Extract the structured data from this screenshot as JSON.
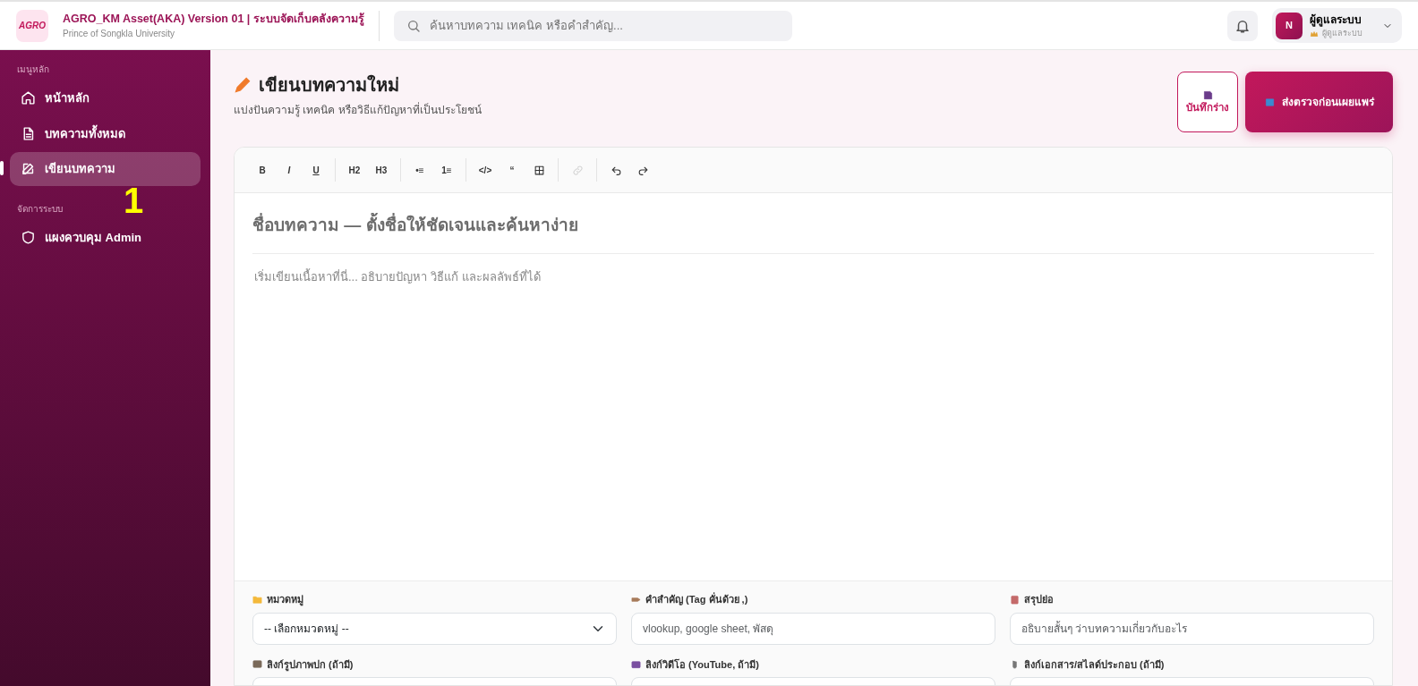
{
  "header": {
    "logo": "AGRO",
    "title": "AGRO_KM Asset(AKA) Version 01 | ระบบจัดเก็บคลังความรู้",
    "subtitle": "Prince of Songkla University",
    "search": {
      "placeholder": "ค้นหาบทความ เทคนิค หรือคำสำคัญ..."
    },
    "user": {
      "avatar": "N",
      "name": "ผู้ดูแลระบบ",
      "role": "ผู้ดูแลระบบ"
    }
  },
  "sidebar": {
    "sections": [
      {
        "heading": "เมนูหลัก",
        "items": [
          {
            "label": "หน้าหลัก",
            "selected": false
          },
          {
            "label": "บทความทั้งหมด",
            "selected": false
          },
          {
            "label": "เขียนบทความ",
            "selected": true
          }
        ]
      },
      {
        "heading": "จัดการระบบ",
        "items": [
          {
            "label": "แผงควบคุม Admin",
            "selected": false
          }
        ]
      }
    ]
  },
  "annotation": "1",
  "page": {
    "title": "เขียนบทความใหม่",
    "subtitle": "แบ่งปันความรู้ เทคนิค หรือวิธีแก้ปัญหาที่เป็นประโยชน์",
    "buttons": [
      {
        "kind": "outline",
        "label": "บันทึกร่าง"
      },
      {
        "kind": "primary",
        "label": "ส่งตรวจก่อนเผยแพร่"
      }
    ]
  },
  "editor": {
    "toolbar": [
      [
        {
          "kind": "bold",
          "label": "B",
          "disabled": false
        },
        {
          "kind": "italic",
          "label": "I",
          "disabled": false
        },
        {
          "kind": "underline",
          "label": "U",
          "disabled": false
        }
      ],
      [
        {
          "kind": "text",
          "label": "H2",
          "disabled": false
        },
        {
          "kind": "text",
          "label": "H3",
          "disabled": false
        }
      ],
      [
        {
          "kind": "text",
          "label": "•≡",
          "disabled": false
        },
        {
          "kind": "text",
          "label": "1≡",
          "disabled": false
        }
      ],
      [
        {
          "kind": "text",
          "label": "</>",
          "disabled": false
        },
        {
          "kind": "text",
          "label": "“",
          "disabled": false
        },
        {
          "kind": "table",
          "disabled": false
        }
      ],
      [
        {
          "kind": "link",
          "disabled": true
        }
      ],
      [
        {
          "kind": "undo",
          "disabled": false
        },
        {
          "kind": "redo",
          "disabled": false
        }
      ]
    ],
    "title_placeholder": "ชื่อบทความ — ตั้งชื่อให้ชัดเจนและค้นหาง่าย",
    "body_placeholder": "เริ่มเขียนเนื้อหาที่นี่... อธิบายปัญหา วิธีแก้ และผลลัพธ์ที่ได้"
  },
  "fields": [
    {
      "label": "หมวดหมู่",
      "kind": "select",
      "value": "-- เลือกหมวดหมู่ --"
    },
    {
      "label": "คำสำคัญ (Tag คั่นด้วย ,)",
      "kind": "input",
      "placeholder": "vlookup, google sheet, พัสดุ"
    },
    {
      "label": "สรุปย่อ",
      "kind": "input",
      "placeholder": "อธิบายสั้นๆ ว่าบทความเกี่ยวกับอะไร"
    },
    {
      "label": "ลิงก์รูปภาพปก (ถ้ามี)",
      "kind": "input"
    },
    {
      "label": "ลิงก์วิดีโอ (YouTube, ถ้ามี)",
      "kind": "input"
    },
    {
      "label": "ลิงก์เอกสาร/สไลด์ประกอบ (ถ้ามี)",
      "kind": "input"
    }
  ]
}
